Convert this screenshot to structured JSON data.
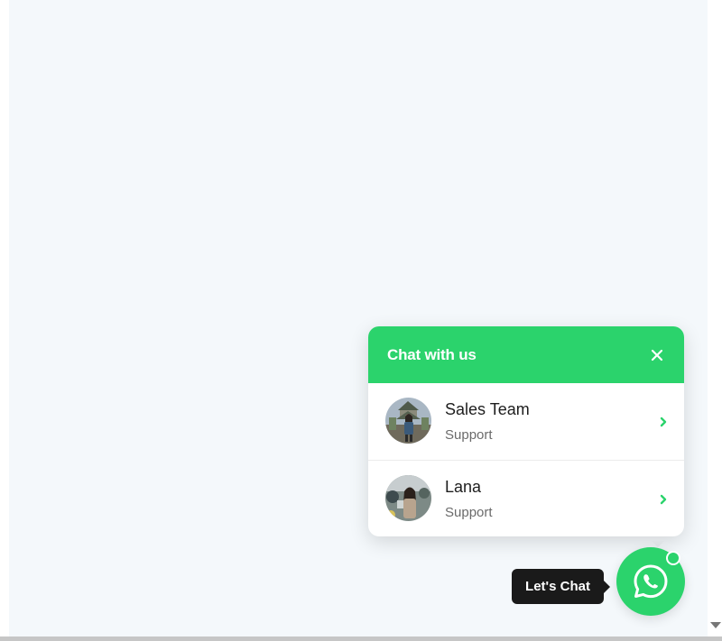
{
  "chat_widget": {
    "title": "Chat with us",
    "accent_color": "#2bd36c",
    "close_icon": "close-icon",
    "agents": [
      {
        "name": "Sales Team",
        "role": "Support",
        "icon": "chevron-right-icon"
      },
      {
        "name": "Lana",
        "role": "Support",
        "icon": "chevron-right-icon"
      }
    ]
  },
  "launcher": {
    "tooltip": "Let's Chat",
    "icon": "whatsapp-icon",
    "status": "online"
  }
}
